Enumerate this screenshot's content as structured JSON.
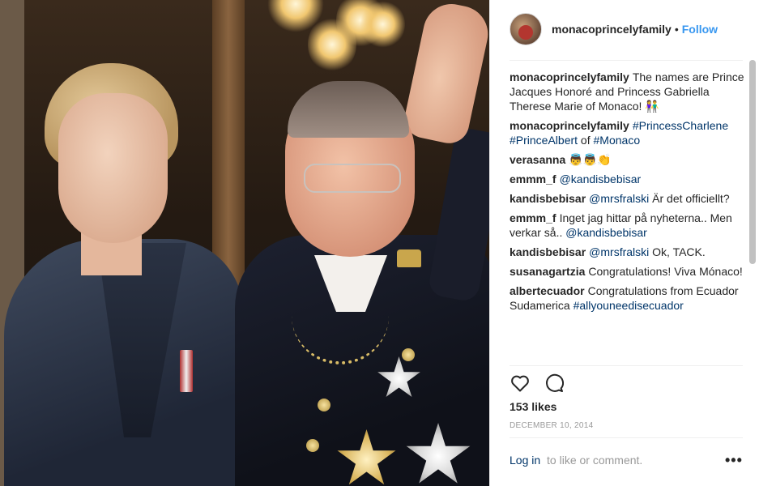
{
  "post": {
    "username": "monacoprincelyfamily",
    "separator": "•",
    "follow_label": "Follow"
  },
  "comments": [
    {
      "user": "monacoprincelyfamily",
      "parts": [
        {
          "t": "text",
          "v": "The names are Prince Jacques Honoré and Princess Gabriella Therese Marie of Monaco! 👫"
        }
      ]
    },
    {
      "user": "monacoprincelyfamily",
      "parts": [
        {
          "t": "link",
          "v": "#PrincessCharlene"
        },
        {
          "t": "text",
          "v": " "
        },
        {
          "t": "link",
          "v": "#PrinceAlbert"
        },
        {
          "t": "text",
          "v": " of "
        },
        {
          "t": "link",
          "v": "#Monaco"
        }
      ]
    },
    {
      "user": "verasanna",
      "parts": [
        {
          "t": "text",
          "v": "👼👼👏"
        }
      ]
    },
    {
      "user": "emmm_f",
      "parts": [
        {
          "t": "link",
          "v": "@kandisbebisar"
        }
      ]
    },
    {
      "user": "kandisbebisar",
      "parts": [
        {
          "t": "link",
          "v": "@mrsfralski"
        },
        {
          "t": "text",
          "v": " Är det officiellt?"
        }
      ]
    },
    {
      "user": "emmm_f",
      "parts": [
        {
          "t": "text",
          "v": "Inget jag hittar på nyheterna.. Men verkar så.. "
        },
        {
          "t": "link",
          "v": "@kandisbebisar"
        }
      ]
    },
    {
      "user": "kandisbebisar",
      "parts": [
        {
          "t": "link",
          "v": "@mrsfralski"
        },
        {
          "t": "text",
          "v": " Ok, TACK."
        }
      ]
    },
    {
      "user": "susanagartzia",
      "parts": [
        {
          "t": "text",
          "v": "Congratulations! Viva Mónaco!"
        }
      ]
    },
    {
      "user": "albertecuador",
      "parts": [
        {
          "t": "text",
          "v": "Congratulations from Ecuador Sudamerica "
        },
        {
          "t": "link",
          "v": "#allyouneedisecuador"
        }
      ]
    }
  ],
  "actions": {
    "like_icon": "heart-icon",
    "comment_icon": "comment-icon"
  },
  "likes_text": "153 likes",
  "date_text": "DECEMBER 10, 2014",
  "footer": {
    "login_link": "Log in",
    "login_rest": "to like or comment.",
    "more_label": "•••"
  },
  "colors": {
    "accent": "#3897f0",
    "link": "#003569",
    "muted": "#999999",
    "text": "#262626"
  }
}
